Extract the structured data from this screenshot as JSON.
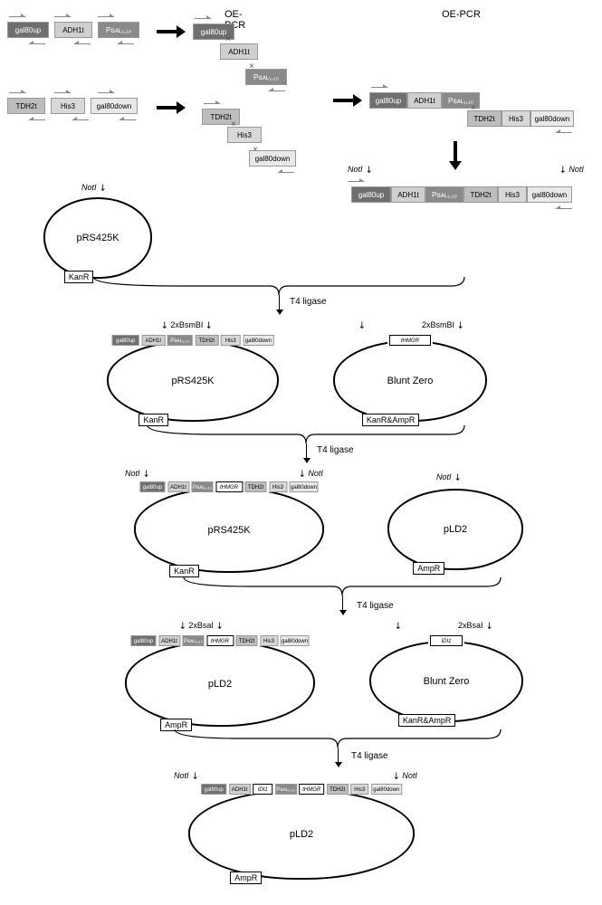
{
  "diagram": {
    "oepcr": "OE-PCR",
    "enzymes": {
      "noti": "NotI",
      "bsmbi": "2xBsmBI",
      "bsai": "2xBsaI",
      "t4": "T4 ligase"
    },
    "fragments": {
      "gal80up": "gal80up",
      "adh1t": "ADH1t",
      "pgal": "Pɢᴀʟ₁,₁₀",
      "tdh2t": "TDH2t",
      "his3": "His3",
      "gal80down": "gal80down",
      "thmgr": "tHMGR",
      "idi1": "IDI1"
    },
    "plasmids": {
      "prs425k": {
        "name": "pRS425K",
        "marker": "KanR"
      },
      "bluntzero": {
        "name": "Blunt Zero",
        "marker": "KanR&AmpR"
      },
      "pld2": {
        "name": "pLD2",
        "marker": "AmpR"
      }
    }
  }
}
